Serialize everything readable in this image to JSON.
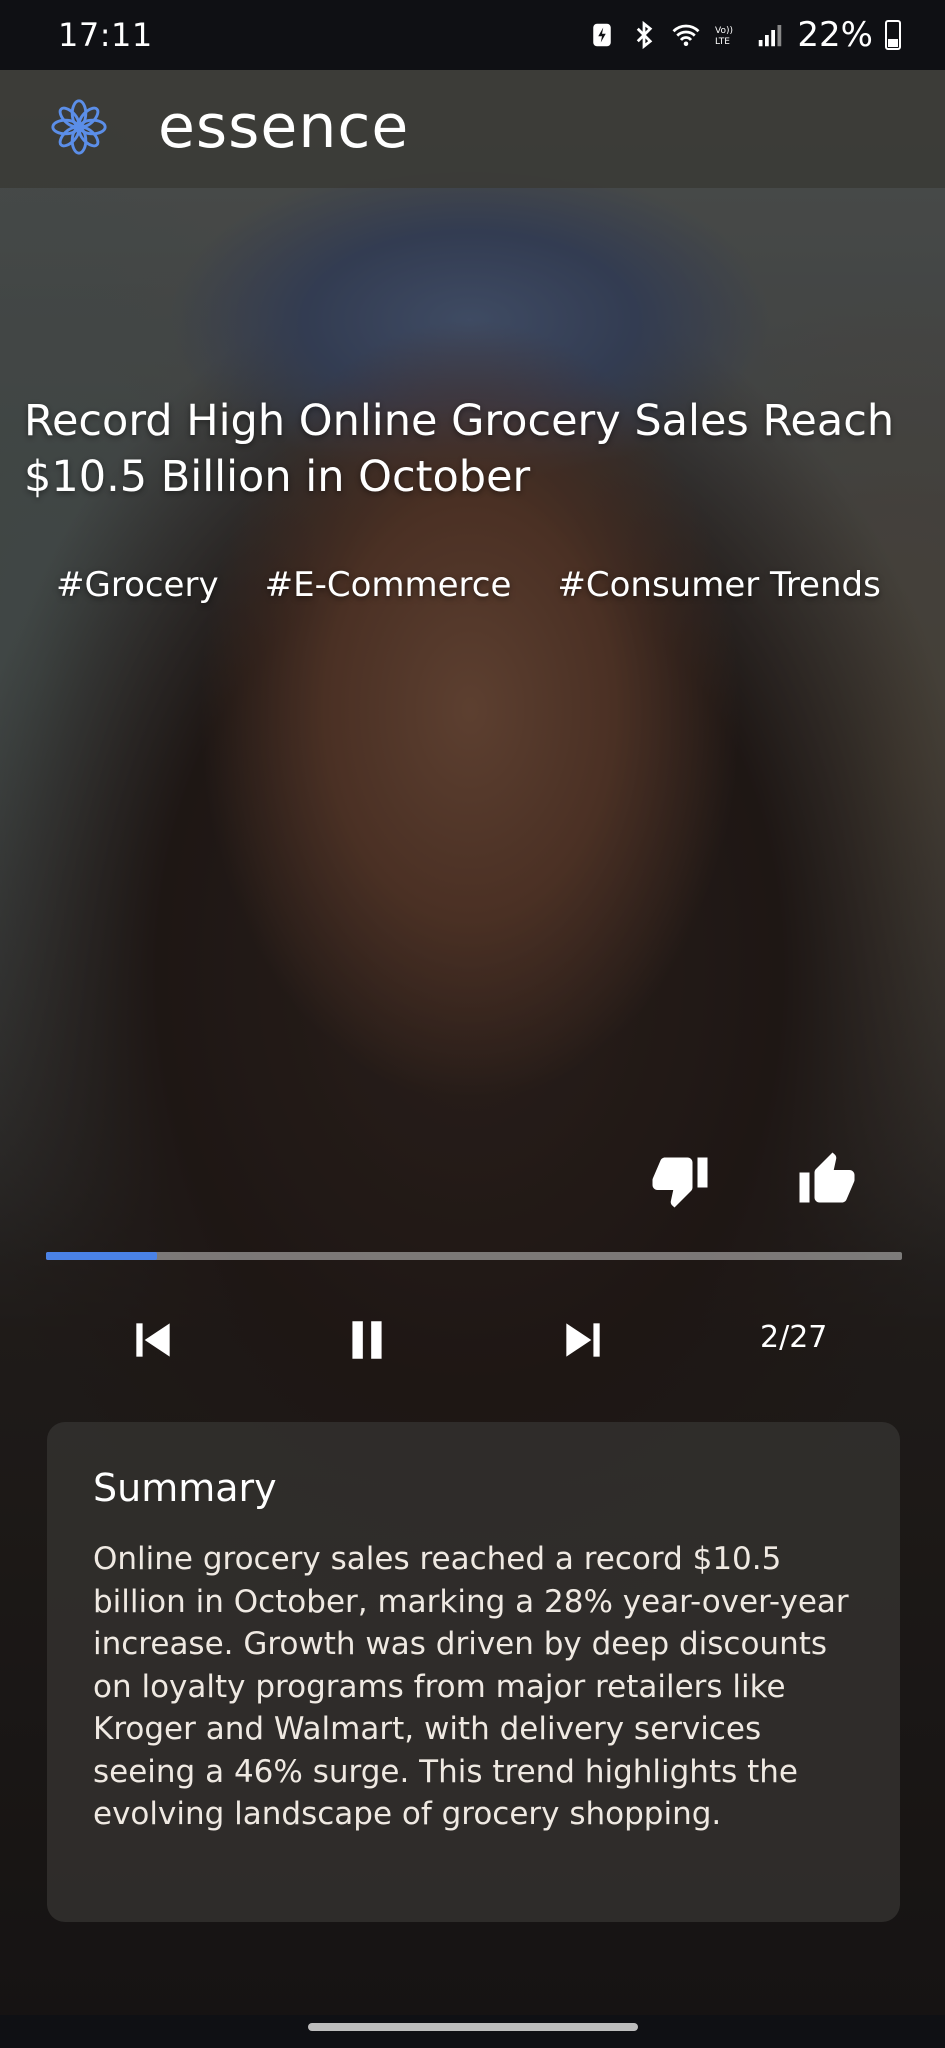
{
  "status_bar": {
    "time": "17:11",
    "battery_percent": "22%",
    "icons": [
      "battery-saver-icon",
      "bluetooth-icon",
      "wifi-icon",
      "volte-icon",
      "signal-icon",
      "battery-icon"
    ],
    "volte_label": "Vo)) LTE"
  },
  "app": {
    "title": "essence",
    "logo_icon": "flower-logo-icon",
    "accent_color": "#4a82e6"
  },
  "article": {
    "headline": "Record High Online Grocery Sales Reach $10.5 Billion in October",
    "tags": [
      "#Grocery",
      "#E-Commerce",
      "#Consumer Trends"
    ]
  },
  "player": {
    "progress_fraction": 0.13,
    "counter": "2/27",
    "controls": [
      "skip-previous-icon",
      "pause-icon",
      "skip-next-icon"
    ],
    "feedback": [
      "thumbs-down-icon",
      "thumbs-up-icon"
    ]
  },
  "summary": {
    "title": "Summary",
    "body": "Online grocery sales reached a record $10.5 billion in October, marking a 28% year-over-year increase. Growth was driven by deep discounts on loyalty programs from major retailers like Kroger and Walmart, with delivery services seeing a 46% surge. This trend highlights the evolving landscape of grocery shopping."
  }
}
